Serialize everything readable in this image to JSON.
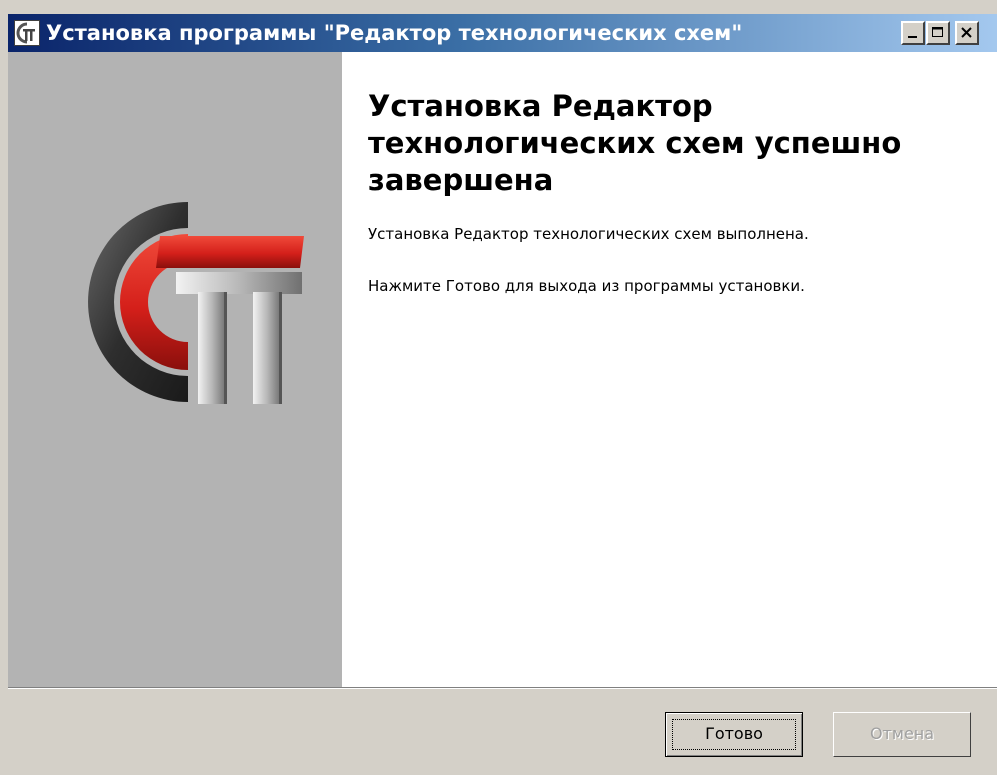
{
  "window": {
    "title": "Установка программы \"Редактор технологических схем\"",
    "controls": {
      "minimize": "minimize-icon",
      "maximize": "maximize-icon",
      "close": "close-icon"
    }
  },
  "side_panel": {
    "logo": "cst-logo"
  },
  "content": {
    "heading": "Установка Редактор технологических схем успешно завершена",
    "message_line1": "Установка Редактор технологических схем выполнена.",
    "message_line2": "Нажмите Готово для выхода из программы установки."
  },
  "buttons": {
    "finish_label": "Готово",
    "cancel_label": "Отмена",
    "cancel_enabled": false
  },
  "colors": {
    "title_bar_start": "#0a246a",
    "title_bar_end": "#a6caf0",
    "side_panel": "#b3b3b3",
    "logo_red": "#d41f1a",
    "dialog_face": "#d4d0c8"
  }
}
